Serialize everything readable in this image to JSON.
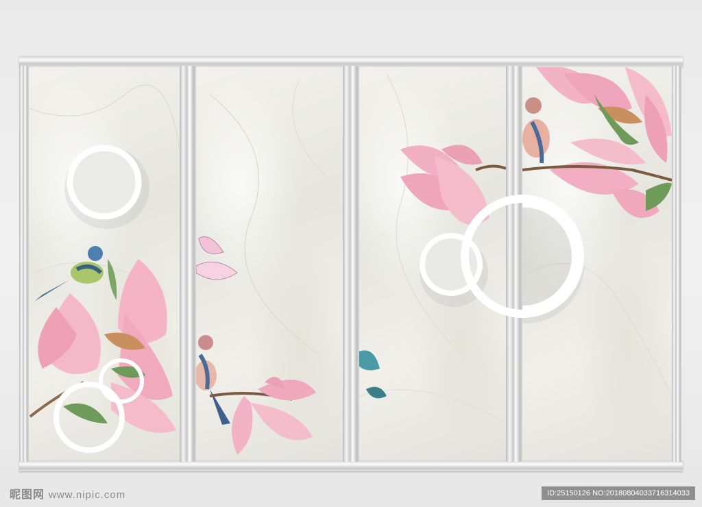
{
  "watermark": {
    "site_cn": "昵图网",
    "site_url": "www.nipic.com"
  },
  "image_id": "ID:25150126 NO:20180804033716314033",
  "colors": {
    "frame": "#e0e0e0",
    "marble": "#efeee8",
    "petal": "#f2a9c0",
    "leaf": "#6e9a5a"
  }
}
